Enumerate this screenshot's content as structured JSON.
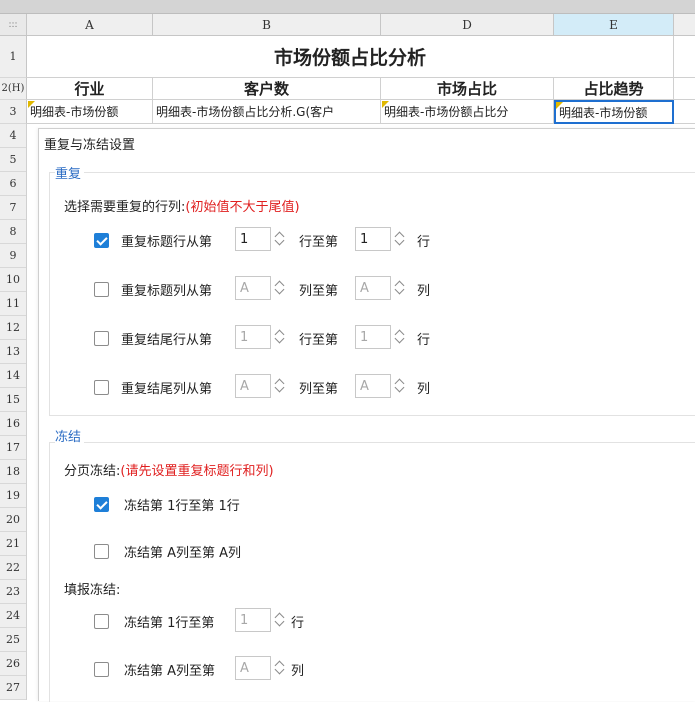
{
  "sheet": {
    "columns": [
      "A",
      "B",
      "D",
      "E"
    ],
    "rows": [
      "1",
      "2(H)",
      "3",
      "4",
      "5",
      "6",
      "7",
      "8",
      "9",
      "10",
      "11",
      "12",
      "13",
      "14",
      "15",
      "16",
      "17",
      "18",
      "19",
      "20",
      "21",
      "22",
      "23",
      "24",
      "25",
      "26",
      "27"
    ],
    "title": "市场份额占比分析",
    "headers": [
      "行业",
      "客户数",
      "市场占比",
      "占比趋势"
    ],
    "fields": [
      "明细表-市场份额",
      "明细表-市场份额占比分析.G(客户",
      "明细表-市场份额占比分",
      "明细表-市场份额"
    ],
    "corner_label": ":::"
  },
  "dialog": {
    "title": "重复与冻结设置",
    "repeat": {
      "section_label": "重复",
      "prompt": "选择需要重复的行列:",
      "hint": "(初始值不大于尾值)",
      "rows": [
        {
          "checked": true,
          "label": "重复标题行从第",
          "from": "1",
          "mid": "行至第",
          "to": "1",
          "unit": "行",
          "enabled": true
        },
        {
          "checked": false,
          "label": "重复标题列从第",
          "from": "A",
          "mid": "列至第",
          "to": "A",
          "unit": "列",
          "enabled": false
        },
        {
          "checked": false,
          "label": "重复结尾行从第",
          "from": "1",
          "mid": "行至第",
          "to": "1",
          "unit": "行",
          "enabled": false
        },
        {
          "checked": false,
          "label": "重复结尾列从第",
          "from": "A",
          "mid": "列至第",
          "to": "A",
          "unit": "列",
          "enabled": false
        }
      ]
    },
    "freeze": {
      "section_label": "冻结",
      "page_label": "分页冻结:",
      "page_hint": "(请先设置重复标题行和列)",
      "page_rows": [
        {
          "checked": true,
          "label": "冻结第 1行至第 1行"
        },
        {
          "checked": false,
          "label": "冻结第 A列至第 A列"
        }
      ],
      "fill_label": "填报冻结:",
      "fill_rows": [
        {
          "checked": false,
          "label": "冻结第 1行至第",
          "value": "1",
          "unit": "行"
        },
        {
          "checked": false,
          "label": "冻结第 A列至第",
          "value": "A",
          "unit": "列"
        }
      ]
    }
  },
  "colors": {
    "accent": "#1e7fd8",
    "section": "#2b6cc4",
    "hint": "#e02020",
    "selected_column": "#d3ecf8",
    "active_cell_border": "#1e6fd0"
  }
}
